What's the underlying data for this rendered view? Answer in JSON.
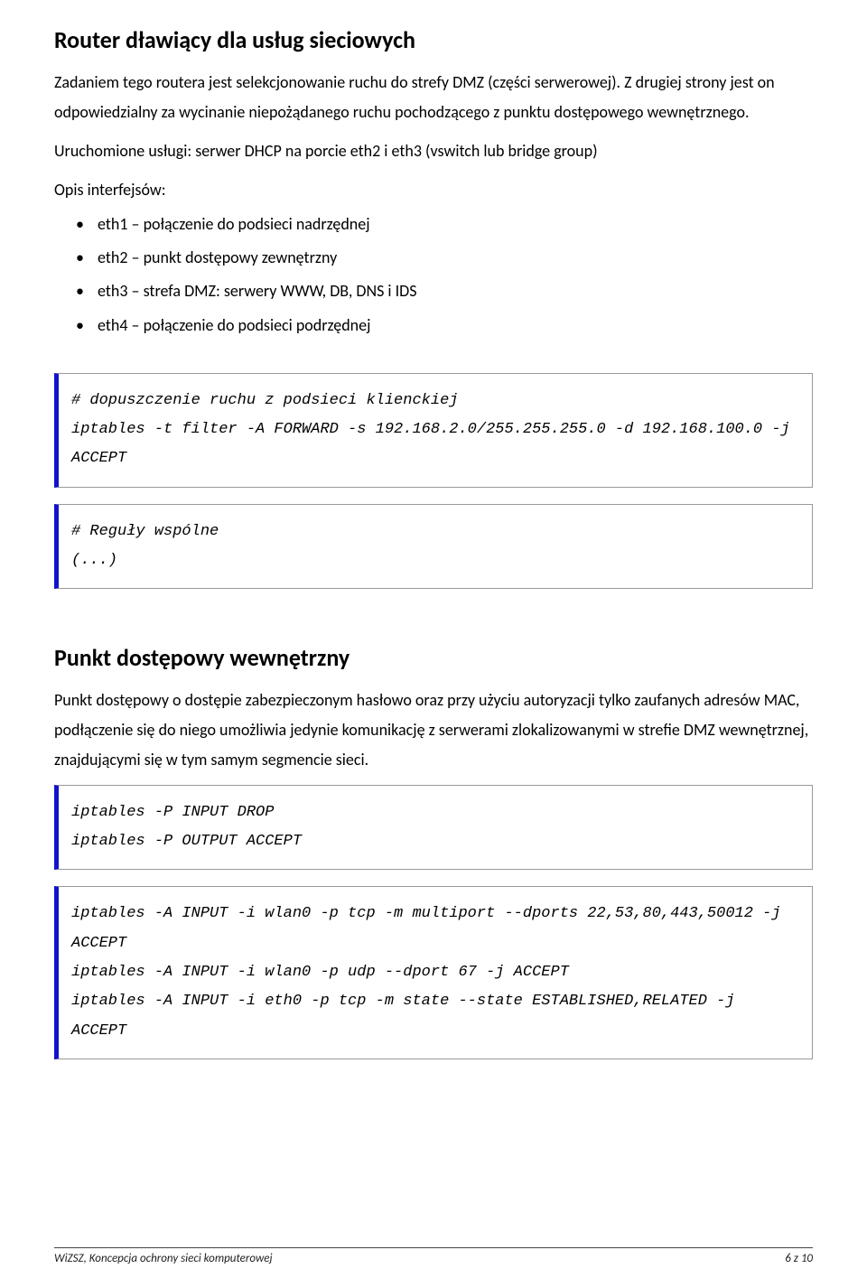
{
  "section1": {
    "heading": "Router dławiący dla usług sieciowych",
    "para1": "Zadaniem tego routera jest selekcjonowanie ruchu do strefy DMZ (części serwerowej). Z drugiej strony jest on odpowiedzialny za wycinanie niepożądanego ruchu pochodzącego z punktu dostępowego wewnętrznego.",
    "para2": "Uruchomione usługi: serwer DHCP na porcie eth2 i eth3 (vswitch lub bridge group)",
    "list_intro": "Opis interfejsów:",
    "items": [
      "eth1 – połączenie do podsieci nadrzędnej",
      "eth2 – punkt dostępowy zewnętrzny",
      "eth3 – strefa DMZ: serwery WWW, DB, DNS i IDS",
      "eth4 – połączenie do podsieci podrzędnej"
    ],
    "code1": "# dopuszczenie ruchu z podsieci klienckiej\niptables -t filter -A FORWARD -s 192.168.2.0/255.255.255.0 -d 192.168.100.0 -j ACCEPT",
    "code2": "# Reguły wspólne\n(...)"
  },
  "section2": {
    "heading": "Punkt dostępowy wewnętrzny",
    "para": "Punkt dostępowy o dostępie zabezpieczonym hasłowo oraz przy użyciu autoryzacji tylko zaufanych adresów MAC, podłączenie się do niego umożliwia jedynie komunikację z serwerami zlokalizowanymi w strefie DMZ wewnętrznej, znajdującymi się w tym samym segmencie sieci.",
    "code1": "iptables -P INPUT DROP\niptables -P OUTPUT ACCEPT",
    "code2": "iptables -A INPUT -i wlan0 -p tcp -m multiport --dports 22,53,80,443,50012 -j ACCEPT\niptables -A INPUT -i wlan0 -p udp --dport 67 -j ACCEPT\niptables -A INPUT -i eth0 -p tcp -m state --state ESTABLISHED,RELATED -j ACCEPT"
  },
  "footer": {
    "left": "WiZSZ, Koncepcja ochrony sieci komputerowej",
    "right": "6 z 10"
  }
}
